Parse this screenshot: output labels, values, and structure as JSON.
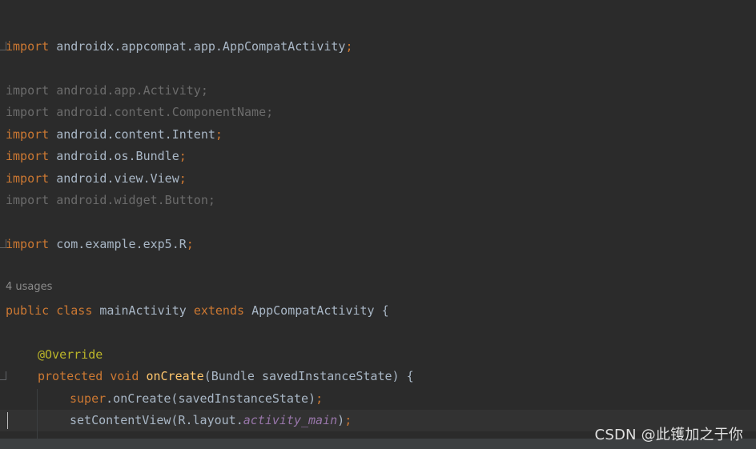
{
  "code": {
    "line_import_appcompat": {
      "kw": "import",
      "pkg": "androidx.appcompat.app.AppCompatActivity",
      "semi": ";"
    },
    "line_import_activity": {
      "kw": "import",
      "pkg": "android.app.Activity",
      "semi": ";"
    },
    "line_import_componentname": {
      "kw": "import",
      "pkg": "android.content.ComponentName",
      "semi": ";"
    },
    "line_import_intent": {
      "kw": "import",
      "pkg": "android.content.Intent",
      "semi": ";"
    },
    "line_import_bundle": {
      "kw": "import",
      "pkg": "android.os.Bundle",
      "semi": ";"
    },
    "line_import_view": {
      "kw": "import",
      "pkg": "android.view.View",
      "semi": ";"
    },
    "line_import_button": {
      "kw": "import",
      "pkg": "android.widget.Button",
      "semi": ";"
    },
    "line_import_r": {
      "kw": "import",
      "pkg": "com.example.exp5.R",
      "semi": ";"
    },
    "usages_hint": "4 usages",
    "class_decl": {
      "kw_public": "public",
      "kw_class": "class",
      "class_name": "mainActivity",
      "kw_extends": "extends",
      "super_name": "AppCompatActivity",
      "brace": "{"
    },
    "annotation": "@Override",
    "method_decl": {
      "kw_protected": "protected",
      "kw_void": "void",
      "method_name": "onCreate",
      "params": "(Bundle savedInstanceState) {"
    },
    "super_call": {
      "kw_super": "super",
      "call": ".onCreate(savedInstanceState)",
      "semi": ";"
    },
    "set_content": {
      "call_prefix": "setContentView(R.layout.",
      "field": "activity_main",
      "call_suffix": ")",
      "semi": ";"
    }
  },
  "watermark": "CSDN @此镬加之于你",
  "colors": {
    "background": "#2b2b2b",
    "keyword": "#cc7832",
    "identifier": "#a9b7c6",
    "unused_import": "#6b6b6b",
    "annotation": "#bbb529",
    "method": "#ffc66d",
    "field": "#9876aa"
  }
}
